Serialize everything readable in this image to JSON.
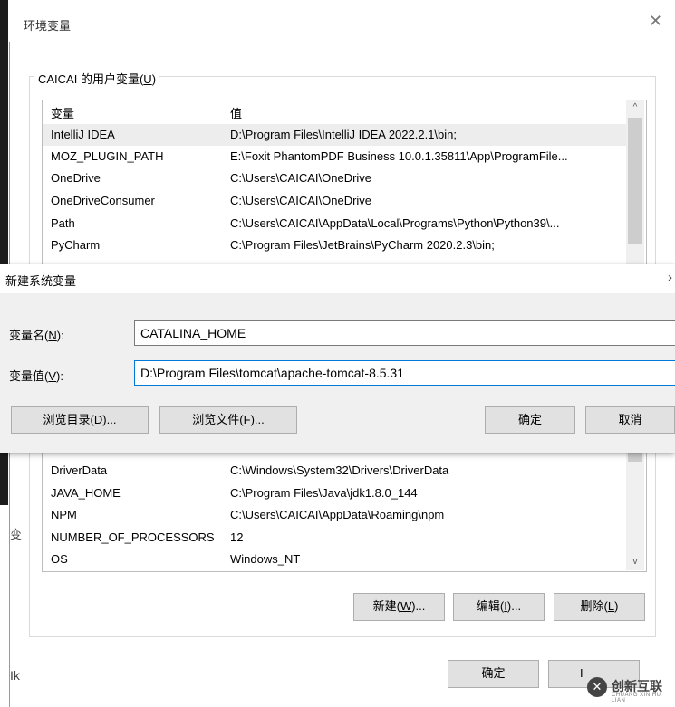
{
  "env_dialog": {
    "title": "环境变量",
    "close_glyph": "✕",
    "user_group_label_prefix": "CAICAI 的用户变量(",
    "user_group_label_key": "U",
    "user_group_label_suffix": ")",
    "columns": {
      "name": "变量",
      "value": "值"
    },
    "user_vars": [
      {
        "name": "IntelliJ IDEA",
        "value": "D:\\Program Files\\IntelliJ IDEA 2022.2.1\\bin;"
      },
      {
        "name": "MOZ_PLUGIN_PATH",
        "value": "E:\\Foxit PhantomPDF Business 10.0.1.35811\\App\\ProgramFile..."
      },
      {
        "name": "OneDrive",
        "value": "C:\\Users\\CAICAI\\OneDrive"
      },
      {
        "name": "OneDriveConsumer",
        "value": "C:\\Users\\CAICAI\\OneDrive"
      },
      {
        "name": "Path",
        "value": "C:\\Users\\CAICAI\\AppData\\Local\\Programs\\Python\\Python39\\..."
      },
      {
        "name": "PyCharm",
        "value": "C:\\Program Files\\JetBrains\\PyCharm 2020.2.3\\bin;"
      }
    ],
    "system_vars": [
      {
        "name": "DriverData",
        "value": "C:\\Windows\\System32\\Drivers\\DriverData"
      },
      {
        "name": "JAVA_HOME",
        "value": "C:\\Program Files\\Java\\jdk1.8.0_144"
      },
      {
        "name": "NPM",
        "value": "C:\\Users\\CAICAI\\AppData\\Roaming\\npm"
      },
      {
        "name": "NUMBER_OF_PROCESSORS",
        "value": "12"
      },
      {
        "name": "OS",
        "value": "Windows_NT"
      }
    ],
    "buttons": {
      "new": {
        "text": "新建(",
        "key": "W",
        "tail": ")..."
      },
      "edit": {
        "text": "编辑(",
        "key": "I",
        "tail": ")..."
      },
      "delete": {
        "text": "删除(",
        "key": "L",
        "tail": ")"
      },
      "ok": "确定",
      "cancel_partial": "I"
    },
    "scroll_up_glyph": "^",
    "scroll_down_glyph": "v",
    "side_text_1": "变",
    "side_text_2": "Ik"
  },
  "new_sys_var_dialog": {
    "title": "新建系统变量",
    "close_glyph": "›",
    "name_label": {
      "text": "变量名(",
      "key": "N",
      "tail": "):"
    },
    "value_label": {
      "text": "变量值(",
      "key": "V",
      "tail": "):"
    },
    "name_value": "CATALINA_HOME",
    "value_value": "D:\\Program Files\\tomcat\\apache-tomcat-8.5.31",
    "buttons": {
      "browse_dir": {
        "text": "浏览目录(",
        "key": "D",
        "tail": ")..."
      },
      "browse_file": {
        "text": "浏览文件(",
        "key": "F",
        "tail": ")..."
      },
      "ok": "确定",
      "cancel": "取消"
    }
  },
  "watermark": {
    "logo_glyph": "✕",
    "brand": "创新互联",
    "sub": "CHUANG XIN HU LIAN"
  }
}
